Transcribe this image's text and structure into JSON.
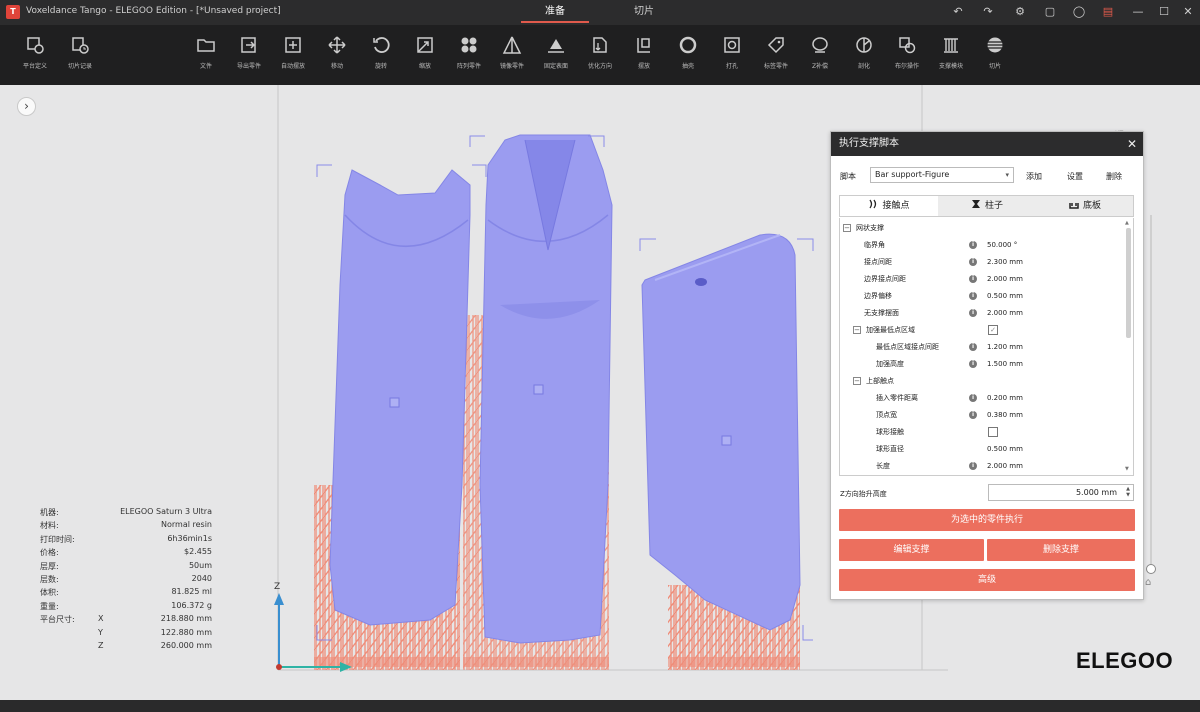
{
  "window": {
    "title": "Voxeldance Tango - ELEGOO Edition - [*Unsaved project]",
    "tabs": [
      {
        "label": "准备",
        "active": true
      },
      {
        "label": "切片",
        "active": false
      }
    ]
  },
  "toolbar": {
    "items": [
      {
        "name": "platform-define",
        "label": "平台定义",
        "icon": "gear-box-icon"
      },
      {
        "name": "slice-record",
        "label": "切片记录",
        "icon": "clock-icon"
      },
      {
        "name": "file",
        "label": "文件",
        "icon": "folder-icon"
      },
      {
        "name": "export-part",
        "label": "导出零件",
        "icon": "export-icon"
      },
      {
        "name": "auto-layout",
        "label": "自动摆放",
        "icon": "plus-box-icon"
      },
      {
        "name": "move",
        "label": "移动",
        "icon": "move-icon"
      },
      {
        "name": "rotate",
        "label": "旋转",
        "icon": "rotate-icon"
      },
      {
        "name": "scale",
        "label": "缩放",
        "icon": "scale-icon"
      },
      {
        "name": "array-parts",
        "label": "阵列零件",
        "icon": "array-icon"
      },
      {
        "name": "mirror-part",
        "label": "镜像零件",
        "icon": "mirror-icon"
      },
      {
        "name": "fixed-surface",
        "label": "固定表面",
        "icon": "surface-icon"
      },
      {
        "name": "optimize-direction",
        "label": "优化方向",
        "icon": "direction-icon"
      },
      {
        "name": "extract",
        "label": "摆放",
        "icon": "extract-icon"
      },
      {
        "name": "hollow",
        "label": "抽壳",
        "icon": "hollow-icon"
      },
      {
        "name": "punch",
        "label": "打孔",
        "icon": "punch-icon"
      },
      {
        "name": "label-part",
        "label": "标签零件",
        "icon": "tag-icon"
      },
      {
        "name": "z-compensate",
        "label": "Z补偿",
        "icon": "z-comp-icon"
      },
      {
        "name": "split",
        "label": "剖化",
        "icon": "split-icon"
      },
      {
        "name": "boolean",
        "label": "布尔操作",
        "icon": "boolean-icon"
      },
      {
        "name": "support-module",
        "label": "支撑模块",
        "icon": "support-icon"
      },
      {
        "name": "slice",
        "label": "切片",
        "icon": "slice-icon"
      }
    ]
  },
  "machine_info": [
    {
      "key": "机器:",
      "value": "ELEGOO Saturn 3 Ultra"
    },
    {
      "key": "材料:",
      "value": "Normal resin"
    },
    {
      "key": "打印时间:",
      "value": "6h36min1s"
    },
    {
      "key": "价格:",
      "value": "$2.455"
    },
    {
      "key": "层厚:",
      "value": "50um"
    },
    {
      "key": "层数:",
      "value": "2040"
    },
    {
      "key": "体积:",
      "value": "81.825 ml"
    },
    {
      "key": "重量:",
      "value": "106.372 g"
    },
    {
      "key": "平台尺寸:",
      "axis": "X",
      "value": "218.880 mm"
    },
    {
      "key": "",
      "axis": "Y",
      "value": "122.880 mm"
    },
    {
      "key": "",
      "axis": "Z",
      "value": "260.000 mm"
    }
  ],
  "brand": "ELEGOO",
  "axis_label": "Z",
  "dialog": {
    "title": "执行支撑脚本",
    "script_label": "脚本",
    "script_value": "Bar support-Figure",
    "add": "添加",
    "settings": "设置",
    "delete": "删除",
    "tabs": [
      {
        "label": "接触点",
        "active": true
      },
      {
        "label": "柱子",
        "active": false
      },
      {
        "label": "底板",
        "active": false
      }
    ],
    "tree": [
      {
        "level": 0,
        "expander": "−",
        "name": "网状支撑"
      },
      {
        "level": 1,
        "name": "临界角",
        "info": true,
        "value": "50.000 °"
      },
      {
        "level": 1,
        "name": "接点间距",
        "info": true,
        "value": "2.300 mm"
      },
      {
        "level": 1,
        "name": "边界接点间距",
        "info": true,
        "value": "2.000 mm"
      },
      {
        "level": 1,
        "name": "边界偏移",
        "info": true,
        "value": "0.500 mm"
      },
      {
        "level": 1,
        "name": "无支撑摆面",
        "info": true,
        "value": "2.000 mm"
      },
      {
        "level": 1,
        "expander": "−",
        "name": "加强最低点区域",
        "check": "checked-disabled"
      },
      {
        "level": 2,
        "name": "最低点区域接点间距",
        "info": true,
        "value": "1.200 mm"
      },
      {
        "level": 2,
        "name": "加强高度",
        "info": true,
        "value": "1.500 mm"
      },
      {
        "level": 1,
        "expander": "−",
        "name": "上部触点"
      },
      {
        "level": 2,
        "name": "插入零件距离",
        "info": true,
        "value": "0.200 mm"
      },
      {
        "level": 2,
        "name": "顶点宽",
        "info": true,
        "value": "0.380 mm"
      },
      {
        "level": 2,
        "name": "球形接触",
        "check": "unchecked"
      },
      {
        "level": 2,
        "name": "球形直径",
        "value": "0.500 mm"
      },
      {
        "level": 2,
        "name": "长度",
        "info": true,
        "value": "2.000 mm"
      }
    ],
    "z_label": "Z方向抬升高度",
    "z_value": "5.000 mm",
    "btn_execute": "为选中的零件执行",
    "btn_edit": "编辑支撑",
    "btn_remove": "删除支撑",
    "btn_advanced": "高级"
  },
  "colors": {
    "model": "#9b9cf0",
    "support": "#ef8c78",
    "accent": "#ec6f5e",
    "titlebar": "#2c2c2d",
    "toolbar": "#1f1f20"
  }
}
